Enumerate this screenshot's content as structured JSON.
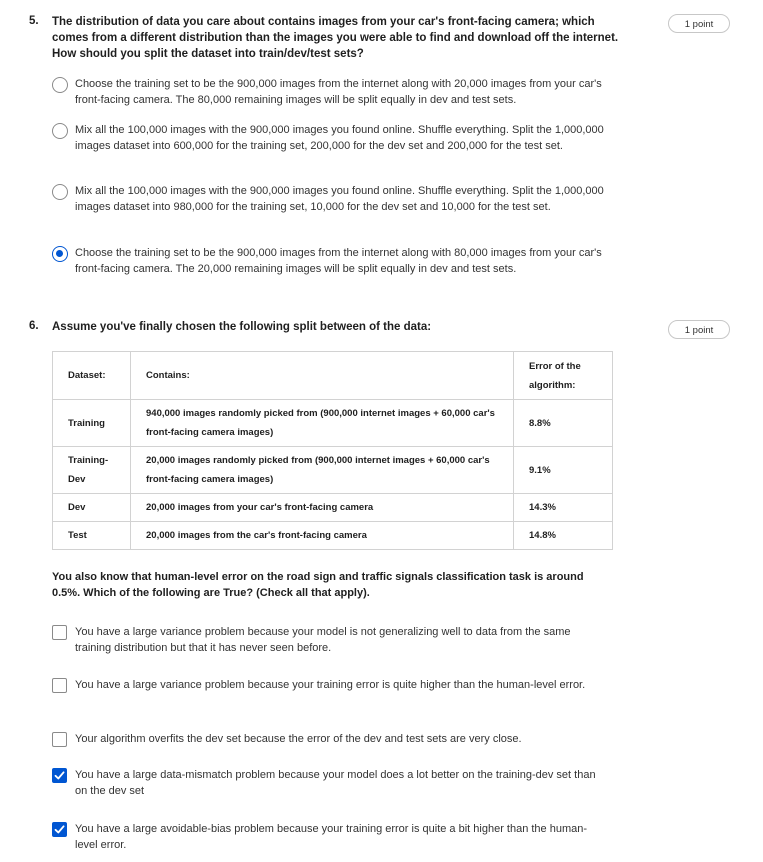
{
  "q5": {
    "number": "5.",
    "text": "The distribution of data you care about contains images from your car's front-facing camera; which comes from a different distribution than the images you were able to find and download off the internet. How should you split the dataset into train/dev/test sets?",
    "points": "1 point",
    "options": [
      {
        "text": "Choose the training set to be the 900,000 images from the internet along with 20,000 images from your car's front-facing camera. The 80,000 remaining images will be split equally in dev and test sets.",
        "selected": false
      },
      {
        "text": "Mix all the 100,000 images with the 900,000 images you found online. Shuffle everything. Split the 1,000,000 images dataset into 600,000 for the training set, 200,000 for the dev set and 200,000 for the test set.",
        "selected": false
      },
      {
        "text": "Mix all the 100,000 images with the 900,000 images you found online. Shuffle everything. Split the 1,000,000 images dataset into 980,000 for the training set, 10,000 for the dev set and 10,000 for the test set.",
        "selected": false
      },
      {
        "text": "Choose the training set to be the 900,000 images from the internet along with 80,000 images from your car's front-facing camera. The 20,000 remaining images will be split equally in dev and test sets.",
        "selected": true
      }
    ]
  },
  "q6": {
    "number": "6.",
    "text": "Assume you've finally chosen the following split between of the data:",
    "points": "1 point",
    "table": {
      "headers": [
        "Dataset:",
        "Contains:",
        "Error of the algorithm:"
      ],
      "rows": [
        [
          "Training",
          "940,000 images randomly picked from (900,000 internet images + 60,000 car's front-facing camera images)",
          "8.8%"
        ],
        [
          "Training-Dev",
          "20,000 images randomly picked from (900,000 internet images + 60,000 car's front-facing camera images)",
          "9.1%"
        ],
        [
          "Dev",
          "20,000 images from your car's front-facing camera",
          "14.3%"
        ],
        [
          "Test",
          "20,000 images from the car's front-facing camera",
          "14.8%"
        ]
      ]
    },
    "subquestion": "You also know that human-level error on the road sign and traffic signals classification task is around 0.5%. Which of the following are True? (Check all that apply).",
    "options": [
      {
        "text": "You have a large variance problem because your model is not generalizing well to data from the same training distribution but that it has never seen before.",
        "checked": false
      },
      {
        "text": "You have a large variance problem because your training error is quite higher than the human-level error.",
        "checked": false
      },
      {
        "text": "Your algorithm overfits the dev set because the error of the dev and test sets are very close.",
        "checked": false
      },
      {
        "text": "You have a large data-mismatch problem because your model does a lot better on the training-dev set than on the dev set",
        "checked": true
      },
      {
        "text": "You have a large avoidable-bias problem because your training error is quite a bit higher than the human-level error.",
        "checked": true
      }
    ]
  }
}
